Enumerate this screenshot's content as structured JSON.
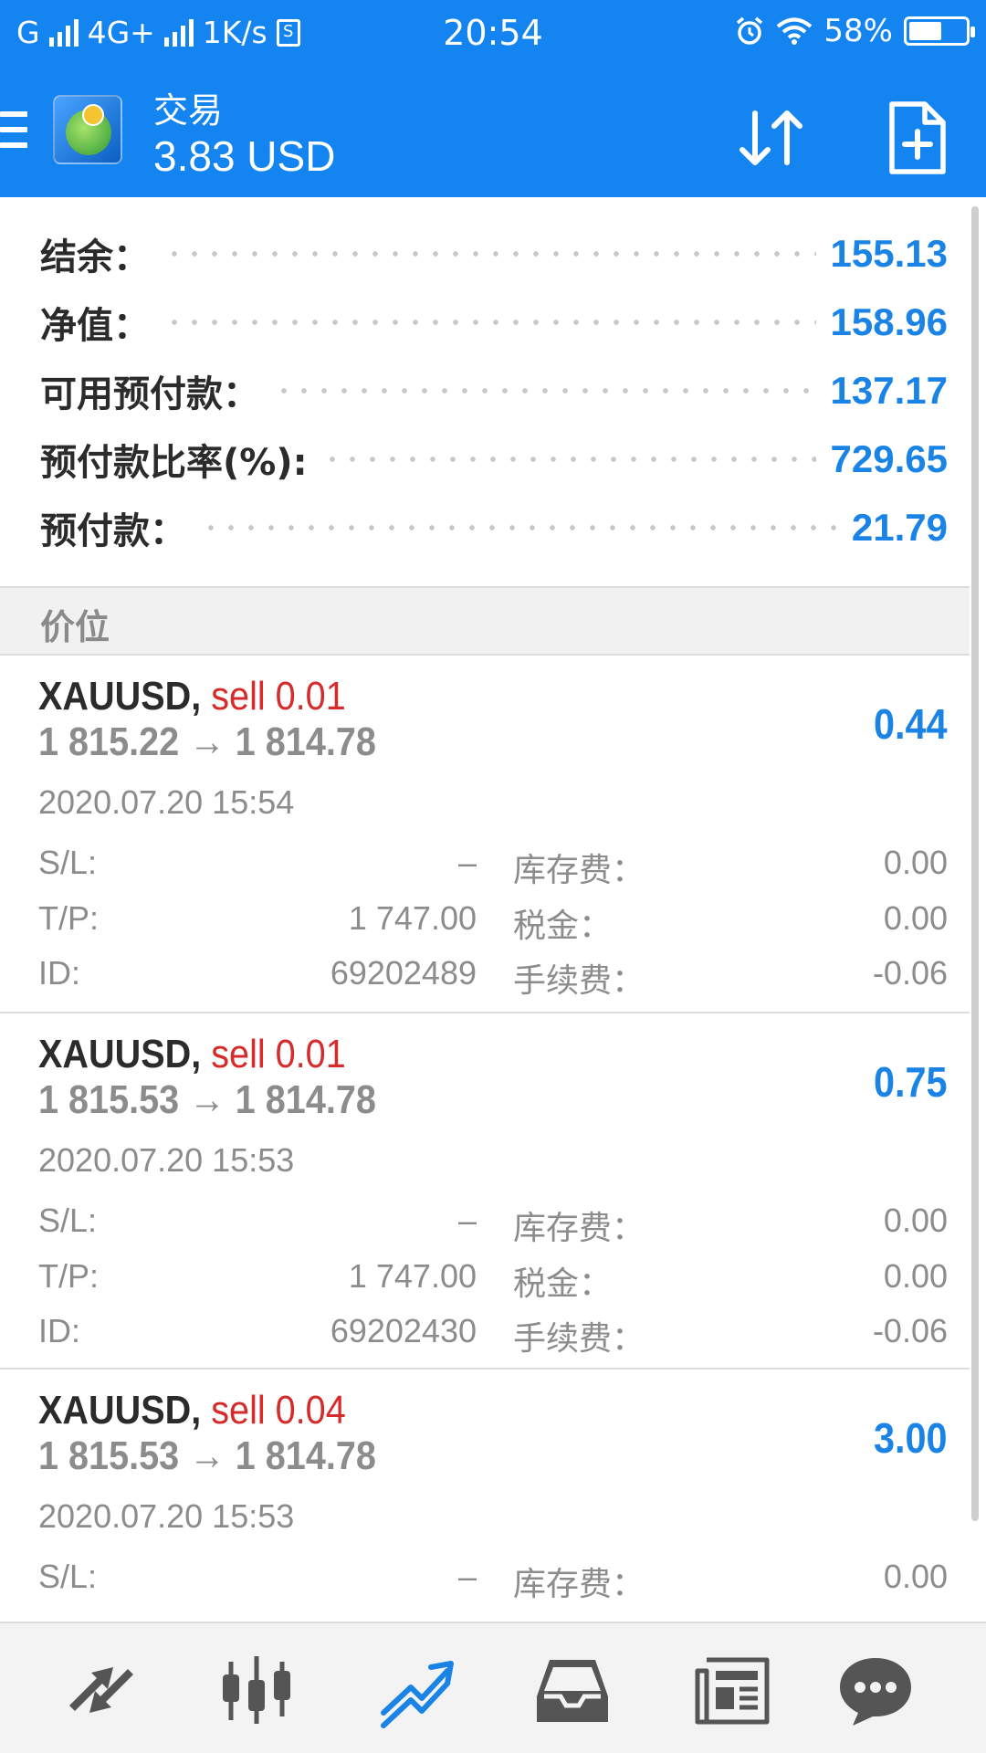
{
  "status_bar": {
    "network_1": "G",
    "network_2": "4G+",
    "speed": "1K/s",
    "sim_label": "S",
    "time": "20:54",
    "battery": "58%",
    "battery_level": 0.58
  },
  "app_bar": {
    "title": "交易",
    "balance": "3.83 USD",
    "icons": [
      "menu-icon",
      "metatrader-logo",
      "sort-icon",
      "new-order-icon"
    ]
  },
  "account": {
    "rows": [
      {
        "label": "结余：",
        "value": "155.13"
      },
      {
        "label": "净值：",
        "value": "158.96"
      },
      {
        "label": "可用预付款：",
        "value": "137.17"
      },
      {
        "label": "预付款比率(%):",
        "value": "729.65"
      },
      {
        "label": "预付款：",
        "value": "21.79"
      }
    ]
  },
  "positions_header": "价位",
  "positions": [
    {
      "symbol": "XAUUSD,",
      "side": "sell 0.01",
      "prices": "1 815.22 → 1 814.78",
      "profit": "0.44",
      "date": "2020.07.20 15:54",
      "details": [
        {
          "k1": "S/L:",
          "v1": "–",
          "k2": "库存费：",
          "v2": "0.00"
        },
        {
          "k1": "T/P:",
          "v1": "1 747.00",
          "k2": "税金：",
          "v2": "0.00"
        },
        {
          "k1": "ID:",
          "v1": "69202489",
          "k2": "手续费：",
          "v2": "-0.06"
        }
      ]
    },
    {
      "symbol": "XAUUSD,",
      "side": "sell 0.01",
      "prices": "1 815.53 → 1 814.78",
      "profit": "0.75",
      "date": "2020.07.20 15:53",
      "details": [
        {
          "k1": "S/L:",
          "v1": "–",
          "k2": "库存费：",
          "v2": "0.00"
        },
        {
          "k1": "T/P:",
          "v1": "1 747.00",
          "k2": "税金：",
          "v2": "0.00"
        },
        {
          "k1": "ID:",
          "v1": "69202430",
          "k2": "手续费：",
          "v2": "-0.06"
        }
      ]
    },
    {
      "symbol": "XAUUSD,",
      "side": "sell 0.04",
      "prices": "1 815.53 → 1 814.78",
      "profit": "3.00",
      "date": "2020.07.20 15:53",
      "details": [
        {
          "k1": "S/L:",
          "v1": "–",
          "k2": "库存费：",
          "v2": "0.00"
        }
      ]
    }
  ],
  "bottom_nav": {
    "items": [
      "quotes-icon",
      "chart-icon",
      "trade-icon",
      "history-icon",
      "news-icon",
      "chat-icon"
    ],
    "active": "trade-icon"
  },
  "colors": {
    "primary": "#1485f0",
    "value_blue": "#1a83e6",
    "sell_red": "#d52b2b",
    "muted_gray": "#8c8c8c"
  }
}
